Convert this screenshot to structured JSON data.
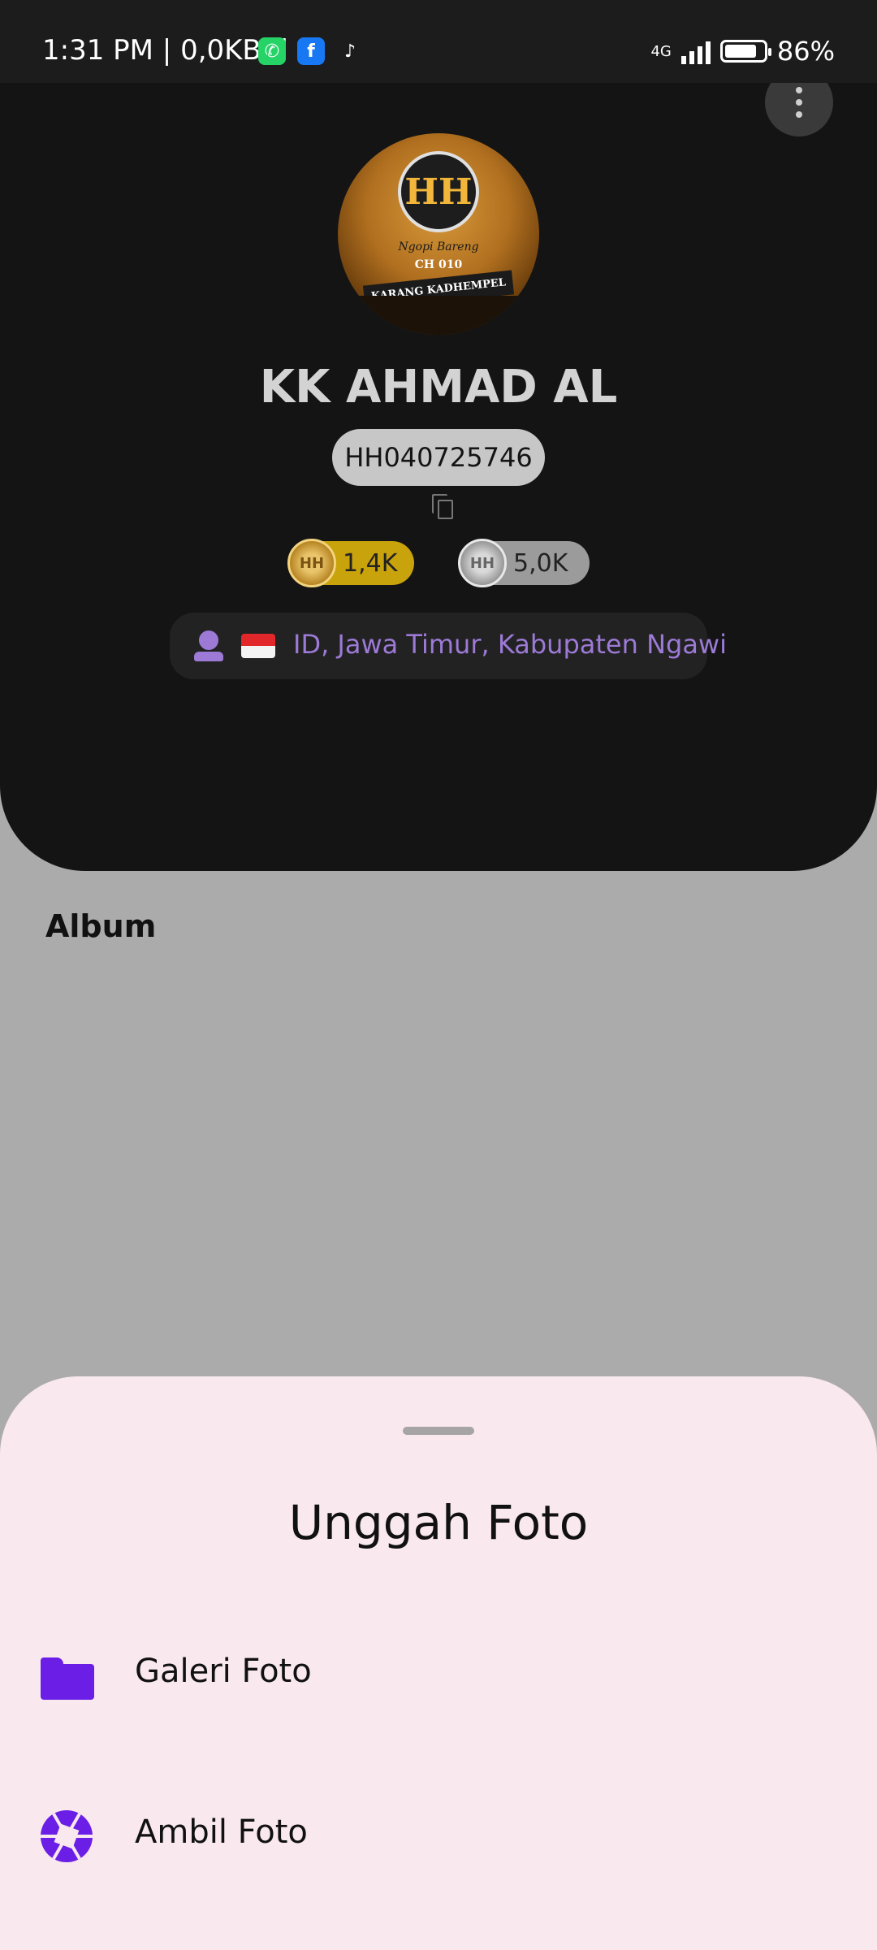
{
  "status_bar": {
    "time_speed": "1:31 PM | 0,0KB/d",
    "network": "4G",
    "battery": "86%",
    "battery_level": 0.86,
    "notification_icons": [
      "whatsapp-icon",
      "facebook-icon",
      "tiktok-icon"
    ]
  },
  "profile": {
    "avatar": {
      "logo_letters": "HH",
      "tagline": "Ngopi Bareng",
      "channel": "CH 010",
      "ribbon": "KARANG KADHEMPEL"
    },
    "name": "KK AHMAD AL",
    "user_id": "HH040725746",
    "gold_count": "1,4K",
    "silver_count": "5,0K",
    "location": "ID, Jawa Timur, Kabupaten Ngawi"
  },
  "album": {
    "title": "Album"
  },
  "bottom_sheet": {
    "title": "Unggah Foto",
    "options": [
      {
        "label": "Galeri Foto",
        "icon": "folder-icon"
      },
      {
        "label": "Ambil Foto",
        "icon": "camera-icon"
      }
    ]
  },
  "colors": {
    "accent": "#6a1ee6",
    "location_text": "#9c7ad6",
    "gold_pill": "#c9a30c",
    "silver_pill": "#9b9b9b",
    "sheet_bg": "#f9e8ee",
    "header_bg": "#141414"
  }
}
